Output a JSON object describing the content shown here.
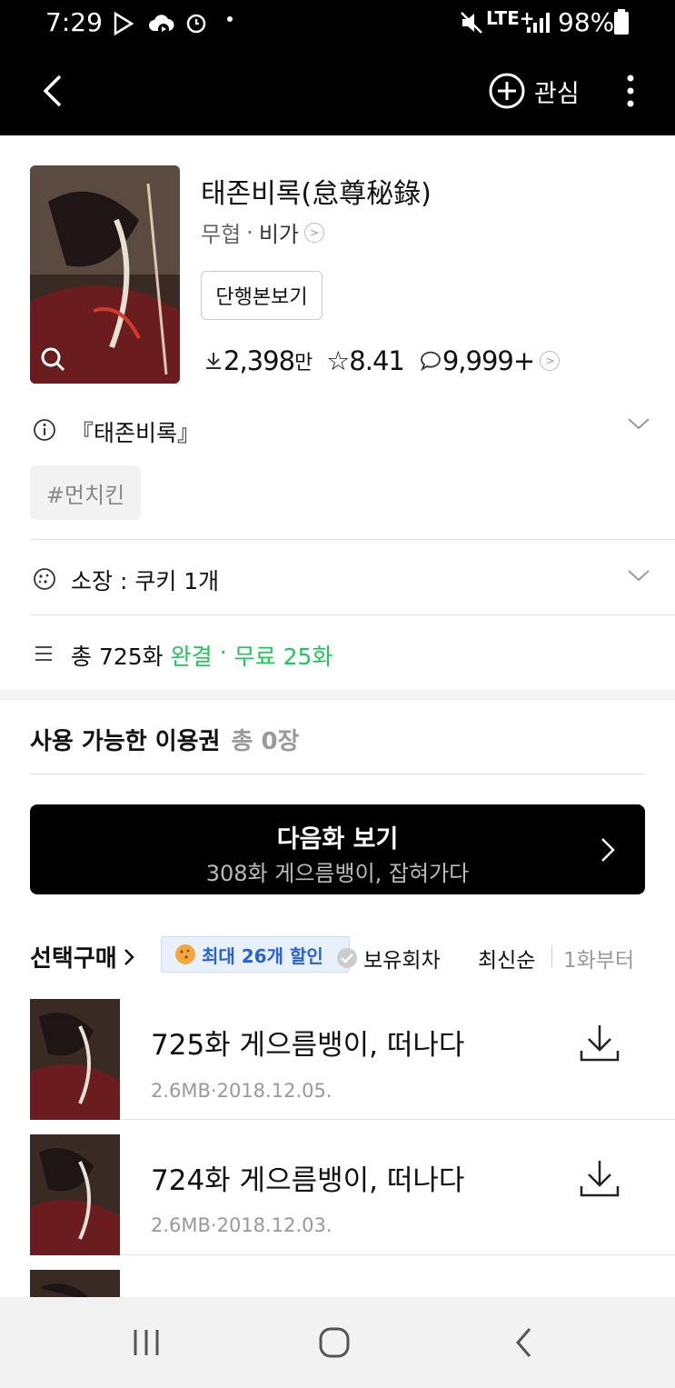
{
  "status_bar": {
    "time": "7:29",
    "network": "LTE+",
    "battery": "98%"
  },
  "app_bar": {
    "favorite_label": "관심"
  },
  "work": {
    "title": "태존비록(怠尊秘錄)",
    "genre": "무협",
    "author": "비가",
    "volume_button": "단행본보기",
    "downloads": "2,398",
    "downloads_unit": "만",
    "rating": "8.41",
    "comments": "9,999+",
    "intro": "『태존비록』",
    "tag": "#먼치킨"
  },
  "ownership": {
    "label": "소장 : 쿠키 1개"
  },
  "episodes_summary": {
    "total": "총 725화",
    "status": "완결",
    "free": "무료 25화"
  },
  "voucher": {
    "label": "사용 가능한 이용권",
    "count": "총 0장"
  },
  "next_episode": {
    "title": "다음화 보기",
    "subtitle": "308화 게으름뱅이, 잡혀가다"
  },
  "list_controls": {
    "select_buy": "선택구매",
    "discount": "최대 26개 할인",
    "owned": "보유회차",
    "latest": "최신순",
    "from_first": "1화부터"
  },
  "episodes": [
    {
      "title": "725화 게으름뱅이, 떠나다",
      "meta": "2.6MB·2018.12.05."
    },
    {
      "title": "724화 게으름뱅이, 떠나다",
      "meta": "2.6MB·2018.12.03."
    }
  ],
  "colors": {
    "accent_green": "#1fc65a",
    "discount_blue": "#2a62d6"
  }
}
